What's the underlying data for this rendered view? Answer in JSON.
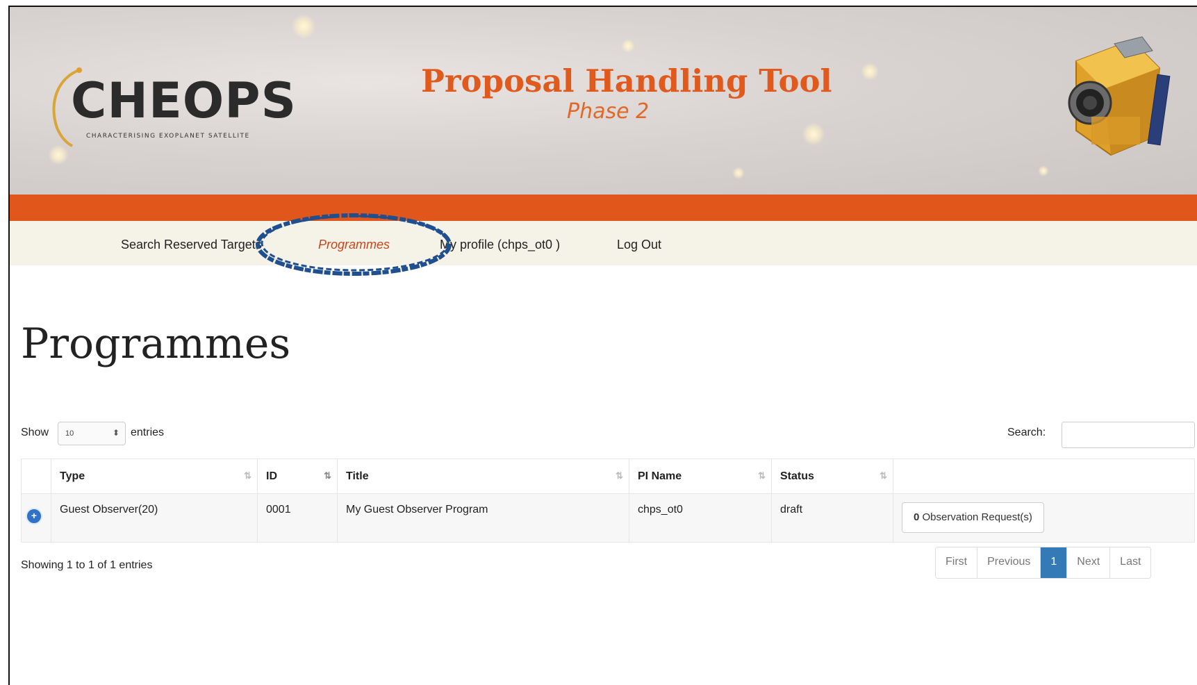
{
  "header": {
    "logo_text": "CHEOPS",
    "logo_subtitle": "CHARACTERISING EXOPLANET SATELLITE",
    "title": "Proposal Handling Tool",
    "subtitle": "Phase 2"
  },
  "nav": {
    "items": [
      {
        "label": "Search Reserved Targets"
      },
      {
        "label": "Programmes",
        "active": true
      },
      {
        "label": "My profile (chps_ot0 )"
      },
      {
        "label": "Log Out"
      }
    ]
  },
  "page": {
    "title": "Programmes"
  },
  "controls": {
    "show_label": "Show",
    "page_size": "10",
    "entries_label": "entries",
    "search_label": "Search:",
    "search_value": ""
  },
  "table": {
    "columns": [
      "Type",
      "ID",
      "Title",
      "PI Name",
      "Status"
    ],
    "rows": [
      {
        "type": "Guest Observer(20)",
        "id": "0001",
        "title": "My Guest Observer Program",
        "pi_name": "chps_ot0",
        "status": "draft",
        "obs_count": "0",
        "obs_label": "Observation Request(s)"
      }
    ]
  },
  "footer": {
    "showing": "Showing 1 to 1 of 1 entries"
  },
  "pagination": {
    "first": "First",
    "previous": "Previous",
    "current": "1",
    "next": "Next",
    "last": "Last"
  },
  "colors": {
    "accent_orange": "#e0561b",
    "title_orange": "#e05a1e",
    "active_nav": "#c9461a",
    "annotation_blue": "#1f4f8f",
    "page_active": "#337ab7"
  }
}
